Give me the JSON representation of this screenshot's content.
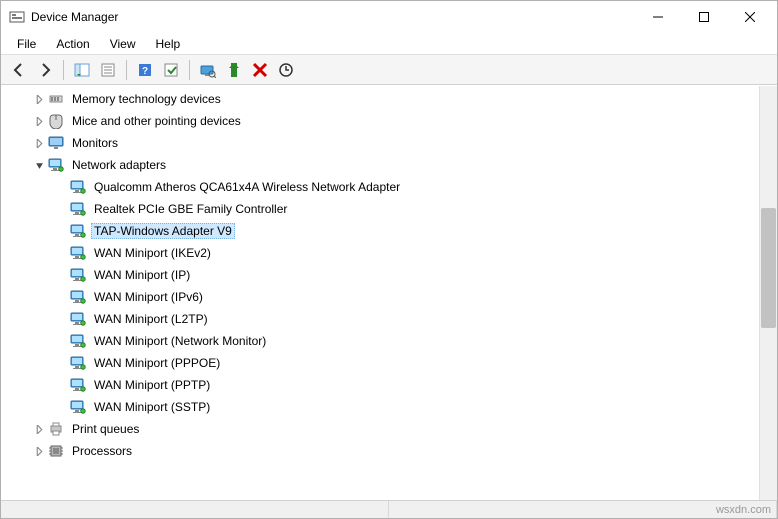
{
  "window": {
    "title": "Device Manager"
  },
  "menubar": {
    "items": [
      "File",
      "Action",
      "View",
      "Help"
    ]
  },
  "tree": {
    "nodes": [
      {
        "indent": 1,
        "expander": "collapsed",
        "icon": "memory",
        "label": "Memory technology devices",
        "selected": false
      },
      {
        "indent": 1,
        "expander": "collapsed",
        "icon": "mouse",
        "label": "Mice and other pointing devices",
        "selected": false
      },
      {
        "indent": 1,
        "expander": "collapsed",
        "icon": "monitor",
        "label": "Monitors",
        "selected": false
      },
      {
        "indent": 1,
        "expander": "expanded",
        "icon": "network",
        "label": "Network adapters",
        "selected": false
      },
      {
        "indent": 2,
        "expander": "none",
        "icon": "network",
        "label": "Qualcomm Atheros QCA61x4A Wireless Network Adapter",
        "selected": false
      },
      {
        "indent": 2,
        "expander": "none",
        "icon": "network",
        "label": "Realtek PCIe GBE Family Controller",
        "selected": false
      },
      {
        "indent": 2,
        "expander": "none",
        "icon": "network",
        "label": "TAP-Windows Adapter V9",
        "selected": true
      },
      {
        "indent": 2,
        "expander": "none",
        "icon": "network",
        "label": "WAN Miniport (IKEv2)",
        "selected": false
      },
      {
        "indent": 2,
        "expander": "none",
        "icon": "network",
        "label": "WAN Miniport (IP)",
        "selected": false
      },
      {
        "indent": 2,
        "expander": "none",
        "icon": "network",
        "label": "WAN Miniport (IPv6)",
        "selected": false
      },
      {
        "indent": 2,
        "expander": "none",
        "icon": "network",
        "label": "WAN Miniport (L2TP)",
        "selected": false
      },
      {
        "indent": 2,
        "expander": "none",
        "icon": "network",
        "label": "WAN Miniport (Network Monitor)",
        "selected": false
      },
      {
        "indent": 2,
        "expander": "none",
        "icon": "network",
        "label": "WAN Miniport (PPPOE)",
        "selected": false
      },
      {
        "indent": 2,
        "expander": "none",
        "icon": "network",
        "label": "WAN Miniport (PPTP)",
        "selected": false
      },
      {
        "indent": 2,
        "expander": "none",
        "icon": "network",
        "label": "WAN Miniport (SSTP)",
        "selected": false
      },
      {
        "indent": 1,
        "expander": "collapsed",
        "icon": "printer",
        "label": "Print queues",
        "selected": false
      },
      {
        "indent": 1,
        "expander": "collapsed",
        "icon": "cpu",
        "label": "Processors",
        "selected": false
      }
    ]
  },
  "watermark": "wsxdn.com"
}
